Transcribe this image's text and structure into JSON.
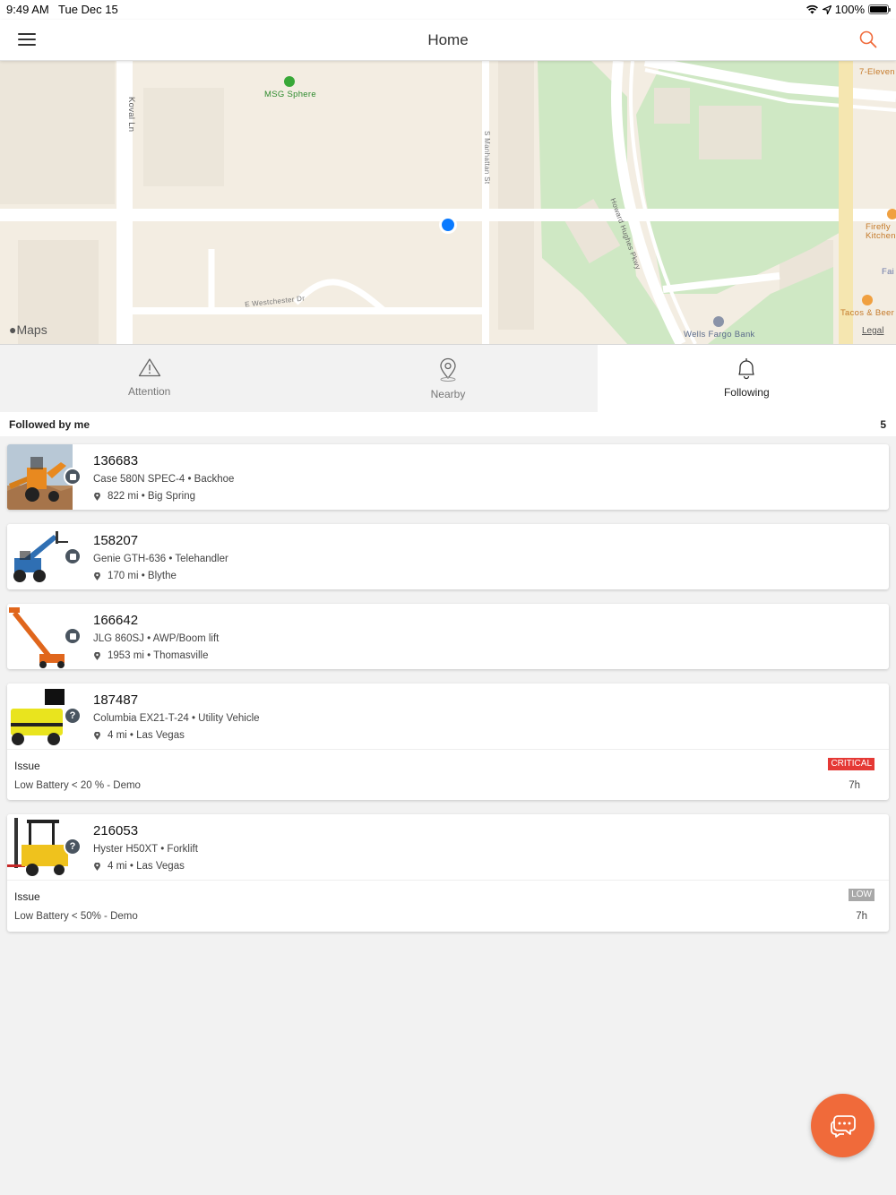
{
  "status_bar": {
    "time": "9:49 AM",
    "date": "Tue Dec 15",
    "battery": "100%"
  },
  "header": {
    "title": "Home"
  },
  "map": {
    "attribution": "Maps",
    "legal": "Legal",
    "places": {
      "msg_sphere": "MSG Sphere",
      "seven_eleven": "7-Eleven",
      "firefly": "Firefly",
      "firefly_2": "Kitchen",
      "fair": "Fai",
      "tacos": "Tacos & Beer",
      "wells_fargo": "Wells Fargo Bank"
    },
    "streets": {
      "koval": "Koval Ln",
      "manhattan": "S Manhattan St",
      "howard": "Howard Hughes Pkwy",
      "westchester": "E Westchester Dr"
    }
  },
  "tabs": [
    {
      "label": "Attention"
    },
    {
      "label": "Nearby"
    },
    {
      "label": "Following"
    }
  ],
  "section": {
    "title": "Followed by me",
    "count": "5"
  },
  "assets": [
    {
      "id": "136683",
      "model": "Case 580N SPEC-4 • Backhoe",
      "location": "822 mi • Big Spring"
    },
    {
      "id": "158207",
      "model": "Genie GTH-636 • Telehandler",
      "location": "170 mi • Blythe"
    },
    {
      "id": "166642",
      "model": "JLG 860SJ • AWP/Boom lift",
      "location": "1953 mi • Thomasville"
    },
    {
      "id": "187487",
      "model": "Columbia EX21-T-24 • Utility Vehicle",
      "location": "4 mi • Las Vegas",
      "issue": {
        "label": "Issue",
        "description": "Low Battery < 20 % - Demo",
        "severity": "CRITICAL",
        "age": "7h"
      }
    },
    {
      "id": "216053",
      "model": "Hyster H50XT • Forklift",
      "location": "4 mi • Las Vegas",
      "issue": {
        "label": "Issue",
        "description": "Low Battery < 50% - Demo",
        "severity": "LOW",
        "age": "7h"
      }
    }
  ],
  "colors": {
    "accent": "#f06a3a",
    "critical": "#e53935",
    "low": "#a8a8a8",
    "user_location": "#0a7aff"
  }
}
